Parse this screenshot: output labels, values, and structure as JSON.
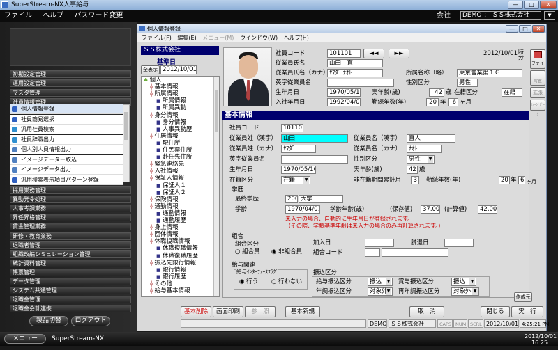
{
  "app": {
    "title": "SuperStream-NX人事給与",
    "menu": [
      "ファイル",
      "ヘルプ",
      "パスワード変更"
    ],
    "company_label": "会社",
    "company_value": "DEMO ： ＳＳ株式会社"
  },
  "sidebar": {
    "top_items": [
      "初期設定管理",
      "運用設定管理",
      "マスタ管理",
      "社員情報管理"
    ],
    "sub_items": [
      "個人情報登録",
      "社員簡易選択",
      "汎用社員検索",
      "社員辞職出力",
      "個人別人員情報出力",
      "イメージデーター取込",
      "イメージデータ出力",
      "汎用検索表示項目パターン登録"
    ],
    "bottom_items": [
      "採用業務管理",
      "異動発令処理",
      "人事考課業務",
      "昇任昇格管理",
      "賃金管理業務",
      "研修・教育業務",
      "退職者管理",
      "組織改編シミュレーション管理",
      "統計資料管理",
      "帳票管理",
      "データ管理",
      "システム共通管理",
      "退職金管理",
      "退職金会計連携"
    ],
    "btn_switch": "製品切替",
    "btn_logout": "ログアウト"
  },
  "taskbar": {
    "menu": "メニュー",
    "product": "SuperStream-NX",
    "date": "2012/10/01",
    "time": "16:25"
  },
  "window": {
    "title": "個人情報登録",
    "menu": [
      "ファイル(F)",
      "編集(E)",
      "メニュー(M)",
      "ウインドウ(W)",
      "ヘルプ(H)"
    ],
    "company": "ＳＳ株式会社",
    "base_date_label": "基準日",
    "base_date_btn": "全表示",
    "base_date": "2012/10/01"
  },
  "tree": [
    "個人",
    "基本情報",
    "所属情報",
    "所属情報",
    "所属異動",
    "身分情報",
    "身分情報",
    "人事異動歴",
    "住居情報",
    "現住所",
    "住民票住所",
    "赴任先住所",
    "緊急連絡先",
    "入社情報",
    "保証人情報",
    "保証人１",
    "保証人２",
    "保険情報",
    "通勤情報",
    "通勤情報",
    "通勤履歴",
    "身上情報",
    "団体情報",
    "休職復職情報",
    "休職復職情報",
    "休職復職履歴",
    "振込先銀行情報",
    "銀行情報",
    "銀行履歴",
    "その他",
    "給与基本情報"
  ],
  "emp": {
    "code_label": "社員コード",
    "code": "101101",
    "nav_prev": "◄◄",
    "nav_next": "►►",
    "date": "2012/10/01",
    "time": "時 分",
    "name_label": "従業員氏名",
    "name": "山田　直",
    "kana_label": "従業員氏名（カナ）",
    "kana": "ﾔﾏﾀﾞ ﾅｵﾄ",
    "shozoku_label": "所属名称（略）",
    "shozoku": "東京営業第１Ｇ",
    "eng_label": "英字従業員名",
    "eng": "",
    "sex_label": "性別区分",
    "sex": "男性",
    "birth_label": "生年月日",
    "birth": "1970/05/10",
    "age_label": "実年齢(歳)",
    "age": "42",
    "age_unit": "歳",
    "status_label": "在籍区分",
    "status": "在籍",
    "join_label": "入社年月日",
    "join": "1992/04/01",
    "tenure_label": "勤続年数(年)",
    "tenure_y": "20",
    "tenure_y_unit": "年",
    "tenure_m": "6",
    "tenure_m_unit": "ヶ月"
  },
  "right_btns": [
    "ファイル",
    "写真",
    "拡張",
    "ｲﾒｰｼﾞﾃﾞｰﾀ"
  ],
  "basic": {
    "header": "基本情報",
    "code_label": "社員コード",
    "code": "101101",
    "sei_label": "従業員姓（漢字）",
    "sei": "山田",
    "mei_label": "従業員名（漢字）",
    "mei": "直人",
    "sei_kana_label": "従業員姓（カナ）",
    "sei_kana": "ﾔﾏﾀﾞ",
    "mei_kana_label": "従業員名（カナ）",
    "mei_kana": "ﾅｵﾄ",
    "eng_label": "英字従業員名",
    "eng": "",
    "sex_label": "性別区分",
    "sex": "男性",
    "birth_label": "生年月日",
    "birth": "1970/05/10",
    "age_label": "実年齢(歳)",
    "age": "42",
    "age_unit": "歳",
    "status_label": "在籍区分",
    "status": "在籍",
    "nonreg_label": "非在籍期間累計月",
    "nonreg": "3",
    "tenure_label": "勤続年数(年)",
    "tenure_y": "20",
    "tenure_y_unit": "年",
    "tenure_m": "6",
    "tenure_m_unit": "ヶ月",
    "edu_label": "学歴",
    "last_edu_label": "最終学歴",
    "last_edu_code": "200",
    "last_edu": "大学",
    "grad_label": "学齢",
    "grad_date": "1970/04/01",
    "grad_age_label": "学齢年齢(歳)",
    "hold_label": "(保存値)",
    "hold_val": "37.00",
    "calc_label": "(計算値)",
    "calc_val": "42.00",
    "note1": "未入力の場合、自動的に生年月日が登録されます。",
    "note2": "（その際、学齢基準年齢は未入力の場合のみ再計算されます。）",
    "union_label": "組合",
    "union_cat_label": "組合区分",
    "union_opt1": "組合員",
    "union_opt2": "非組合員",
    "join_date_label": "加入日",
    "leave_date_label": "脱退日",
    "union_code_label": "組合コード",
    "pay_label": "給与関連",
    "pay_if_label": "給与ｲﾝﾀｰﾌｪｰｽﾌﾗｸﾞ",
    "pay_if_opt1": "行う",
    "pay_if_opt2": "行わない",
    "transfer_label": "振込区分",
    "t1_label": "給与振込区分",
    "t1": "振込",
    "t2_label": "賞与振込区分",
    "t2": "振込",
    "t3_label": "年調振込区分",
    "t3": "対象外",
    "t4_label": "再年調振込区分",
    "t4": "対象外",
    "new_btn": "作成元"
  },
  "buttons": {
    "delete": "基本削除",
    "print": "画面印刷",
    "ref": "参　照",
    "new": "基本新規",
    "cancel": "取　消",
    "close": "閉じる",
    "exec": "実　行"
  },
  "status": {
    "s1": "DEMO",
    "s2": "ＳＳ株式会社",
    "caps": "CAPS",
    "num": "NUM",
    "scrl": "SCRL",
    "date": "2012/10/01",
    "time": "4:25:21 PM"
  },
  "colors": {
    "accent": "#00006e",
    "highlight": "#00ffff",
    "note": "#cc0000"
  }
}
